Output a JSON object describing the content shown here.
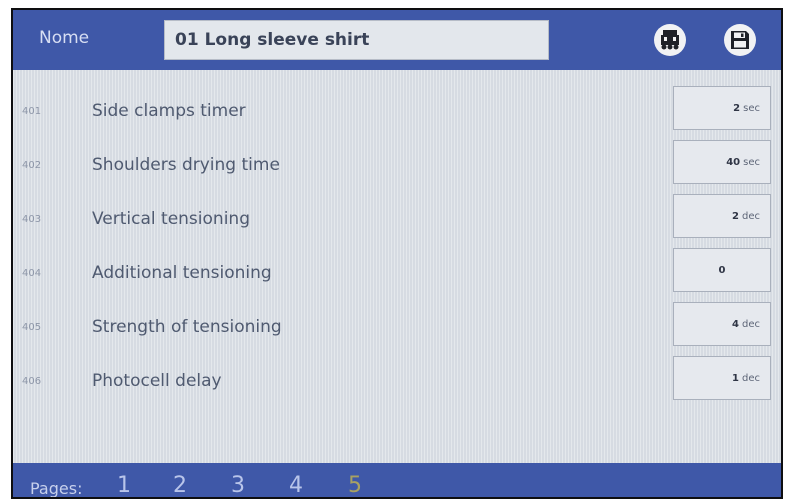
{
  "header": {
    "name_label": "Nome",
    "program_name": "01 Long sleeve shirt",
    "buttons": [
      {
        "icon": "conveyor-machine-icon"
      },
      {
        "icon": "floppy-disk-icon"
      }
    ]
  },
  "rows": [
    {
      "code": "401",
      "label": "Side clamps timer",
      "value": "2",
      "unit": "sec"
    },
    {
      "code": "402",
      "label": "Shoulders drying time",
      "value": "40",
      "unit": "sec"
    },
    {
      "code": "403",
      "label": "Vertical tensioning",
      "value": "2",
      "unit": "dec"
    },
    {
      "code": "404",
      "label": "Additional tensioning",
      "value": "0",
      "unit": ""
    },
    {
      "code": "405",
      "label": "Strength of tensioning",
      "value": "4",
      "unit": "dec"
    },
    {
      "code": "406",
      "label": "Photocell delay",
      "value": "1",
      "unit": "dec"
    }
  ],
  "footer": {
    "pages_label": "Pages:",
    "pages": [
      "1",
      "2",
      "3",
      "4",
      "5"
    ],
    "current_page": "5"
  },
  "colors": {
    "header_bg": "#3f58a8",
    "content_bg": "#d6dbe2",
    "current_page": "#a9a262"
  }
}
